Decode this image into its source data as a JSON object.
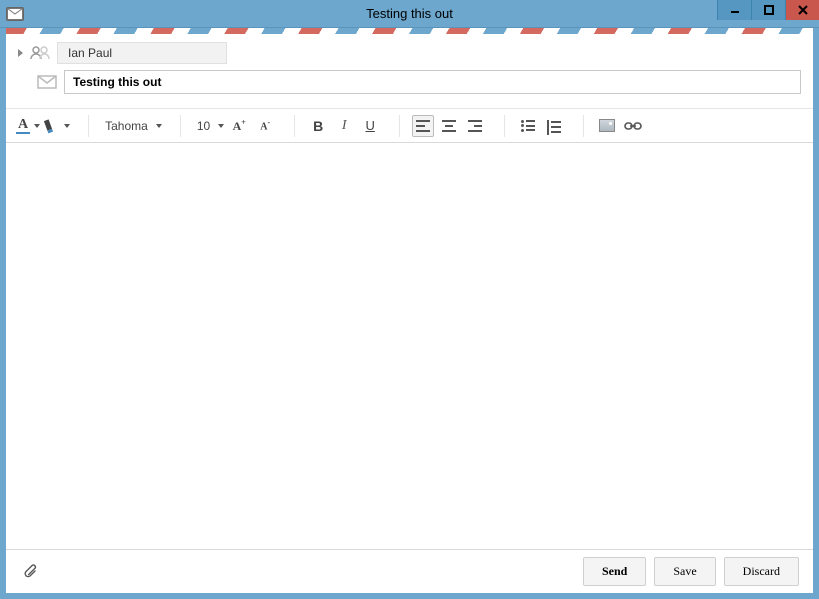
{
  "titlebar": {
    "title": "Testing this out"
  },
  "header": {
    "recipient": "Ian Paul",
    "subject": "Testing this out"
  },
  "toolbar": {
    "font_name": "Tahoma",
    "font_size": "10",
    "font_color_glyph": "A",
    "increase_glyph": "A",
    "increase_sup": "+",
    "decrease_glyph": "A",
    "decrease_sup": "-",
    "bold_glyph": "B",
    "italic_glyph": "I",
    "underline_glyph": "U"
  },
  "buttons": {
    "send": "Send",
    "save": "Save",
    "discard": "Discard"
  }
}
